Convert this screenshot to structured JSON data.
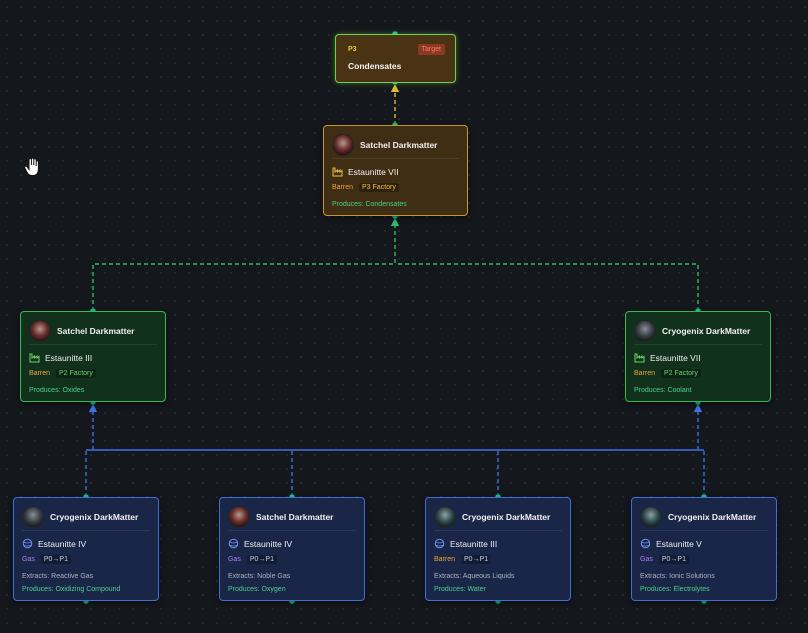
{
  "target": {
    "tier": "P3",
    "badge": "Target",
    "name": "Condensates"
  },
  "level1": {
    "character": "Satchel Darkmatter",
    "planet": "Estaunitte VII",
    "planet_type": "Barren",
    "facility": "P3 Factory",
    "produces": "Produces: Condensates"
  },
  "level2": [
    {
      "character": "Satchel Darkmatter",
      "planet": "Estaunitte III",
      "planet_type": "Barren",
      "facility": "P2 Factory",
      "produces": "Produces: Oxides"
    },
    {
      "character": "Cryogenix DarkMatter",
      "planet": "Estaunitte VII",
      "planet_type": "Barren",
      "facility": "P2 Factory",
      "produces": "Produces: Coolant"
    }
  ],
  "level3": [
    {
      "character": "Cryogenix DarkMatter",
      "planet": "Estaunitte IV",
      "planet_type": "Gas",
      "facility": "P0→P1",
      "extracts": "Extracts: Reactive Gas",
      "produces": "Produces: Oxidizing Compound"
    },
    {
      "character": "Satchel Darkmatter",
      "planet": "Estaunitte IV",
      "planet_type": "Gas",
      "facility": "P0→P1",
      "extracts": "Extracts: Noble Gas",
      "produces": "Produces: Oxygen"
    },
    {
      "character": "Cryogenix DarkMatter",
      "planet": "Estaunitte III",
      "planet_type": "Barren",
      "facility": "P0→P1",
      "extracts": "Extracts: Aqueous Liquids",
      "produces": "Produces: Water"
    },
    {
      "character": "Cryogenix DarkMatter",
      "planet": "Estaunitte V",
      "planet_type": "Gas",
      "facility": "P0→P1",
      "extracts": "Extracts: Ionic Solutions",
      "produces": "Produces: Electrolytes"
    }
  ],
  "colors": {
    "amber_edge": "#e0b82c",
    "green_edge": "#2ebd6a",
    "blue_edge": "#3f72e0",
    "handle": "#1fc98f"
  },
  "icons": {
    "factory": "factory-icon",
    "planet": "planet-icon",
    "cursor": "hand-cursor-icon"
  }
}
